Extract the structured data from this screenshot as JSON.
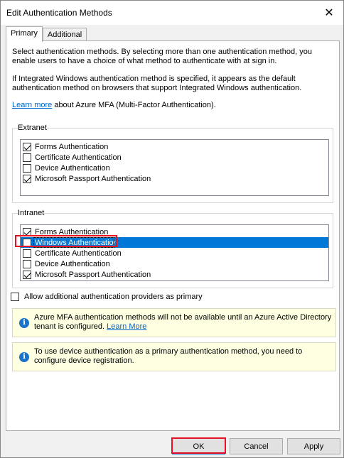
{
  "window": {
    "title": "Edit Authentication Methods",
    "close_glyph": "✕"
  },
  "tabs": [
    {
      "label": "Primary",
      "active": true
    },
    {
      "label": "Additional",
      "active": false
    }
  ],
  "intro": {
    "p1": "Select authentication methods. By selecting more than one authentication method, you enable users to have a choice of what method to authenticate with at sign in.",
    "p2": "If Integrated Windows authentication method is specified, it appears as the default authentication method on browsers that support Integrated Windows authentication.",
    "learn_more_link": "Learn more",
    "learn_more_suffix": " about Azure MFA (Multi-Factor Authentication)."
  },
  "extranet": {
    "label": "Extranet",
    "items": [
      {
        "label": "Forms Authentication",
        "checked": true
      },
      {
        "label": "Certificate Authentication",
        "checked": false
      },
      {
        "label": "Device Authentication",
        "checked": false
      },
      {
        "label": "Microsoft Passport Authentication",
        "checked": true
      }
    ]
  },
  "intranet": {
    "label": "Intranet",
    "items": [
      {
        "label": "Forms Authentication",
        "checked": true,
        "selected": false
      },
      {
        "label": "Windows Authentication",
        "checked": false,
        "selected": true
      },
      {
        "label": "Certificate Authentication",
        "checked": false,
        "selected": false
      },
      {
        "label": "Device Authentication",
        "checked": false,
        "selected": false
      },
      {
        "label": "Microsoft Passport Authentication",
        "checked": true,
        "selected": false
      }
    ]
  },
  "allow_additional": {
    "label": "Allow additional authentication providers as primary",
    "checked": false
  },
  "info1": {
    "text": "Azure MFA authentication methods will not be available until an Azure Active Directory tenant is configured. ",
    "link": "Learn More"
  },
  "info2": {
    "text": "To use device authentication as a primary authentication method, you need to configure device registration."
  },
  "buttons": {
    "ok": "OK",
    "cancel": "Cancel",
    "apply": "Apply"
  },
  "colors": {
    "selection": "#0078d7",
    "highlight_box": "#e81123",
    "info_bg": "#ffffe1",
    "link": "#0066cc"
  },
  "icons": {
    "info": "info-icon",
    "close": "close-icon"
  }
}
